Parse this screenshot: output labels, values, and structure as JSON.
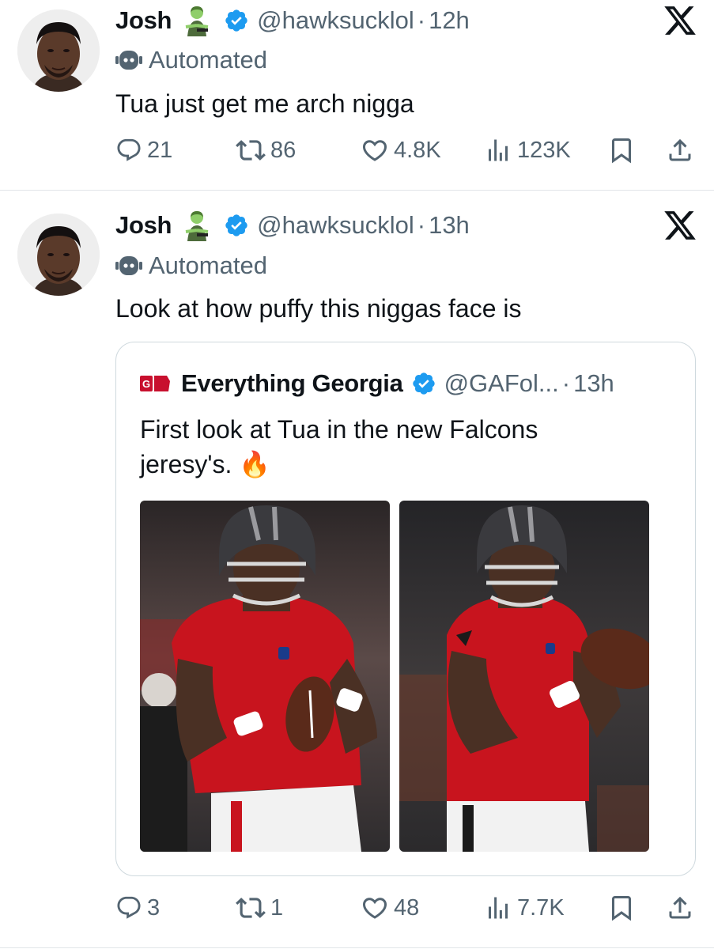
{
  "tweets": [
    {
      "name": "Josh",
      "handle": "@hawksucklol",
      "separator": "·",
      "time": "12h",
      "automated_label": "Automated",
      "text": "Tua just get me arch nigga",
      "stats": {
        "replies": "21",
        "reposts": "86",
        "likes": "4.8K",
        "views": "123K"
      }
    },
    {
      "name": "Josh",
      "handle": "@hawksucklol",
      "separator": "·",
      "time": "13h",
      "automated_label": "Automated",
      "text": "Look at how puffy this niggas face is",
      "quote": {
        "name": "Everything Georgia",
        "handle": "@GAFol...",
        "separator": "·",
        "time": "13h",
        "text_line1": "First look at Tua in the new Falcons",
        "text_line2": "jeresy's.",
        "emoji": "🔥"
      },
      "stats": {
        "replies": "3",
        "reposts": "1",
        "likes": "48",
        "views": "7.7K"
      }
    }
  ],
  "icons": {
    "verified": "verified-badge-icon",
    "x_logo": "x-logo-icon",
    "automated": "bot-icon",
    "reply": "reply-icon",
    "repost": "repost-icon",
    "like": "heart-icon",
    "views": "views-icon",
    "bookmark": "bookmark-icon",
    "share": "share-icon"
  },
  "colors": {
    "text": "#0f1419",
    "secondary": "#536471",
    "verified": "#1d9bf0",
    "falcons_red": "#c8102e"
  }
}
